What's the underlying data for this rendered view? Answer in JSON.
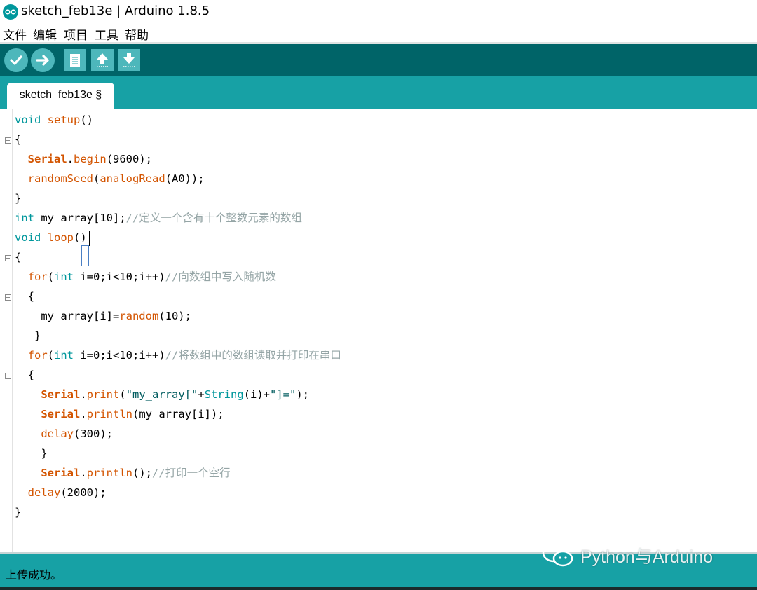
{
  "window": {
    "title": "sketch_feb13e | Arduino 1.8.5"
  },
  "menu": {
    "items": [
      "文件",
      "编辑",
      "项目",
      "工具",
      "帮助"
    ]
  },
  "toolbar": {
    "buttons": [
      "verify-icon",
      "upload-icon",
      "new-icon",
      "open-icon",
      "save-icon"
    ]
  },
  "tab": {
    "label": "sketch_feb13e §"
  },
  "code": {
    "l1": {
      "kw": "void",
      "fn": "setup",
      "rest": "()"
    },
    "l2": "{",
    "l3": {
      "ser": "Serial",
      "dot": ".",
      "fn": "begin",
      "rest": "(9600);"
    },
    "l4": {
      "fn": "randomSeed",
      "p1": "(",
      "fn2": "analogRead",
      "rest": "(A0));"
    },
    "l5": "}",
    "l6": {
      "kw": "int",
      "rest": " my_array[10];",
      "cm": "//定义一个含有十个整数元素的数组"
    },
    "l7": {
      "kw": "void",
      "fn": "loop",
      "rest": "()"
    },
    "l8": "{",
    "l9": {
      "kw": "for",
      "p1": "(",
      "kw2": "int",
      "rest": " i=0;i<10;i++)",
      "cm": "//向数组中写入随机数"
    },
    "l10": "{",
    "l11": {
      "rest": "my_array[i]=",
      "fn": "random",
      "rest2": "(10);"
    },
    "l12": "}",
    "l13": {
      "kw": "for",
      "p1": "(",
      "kw2": "int",
      "rest": " i=0;i<10;i++)",
      "cm": "//将数组中的数组读取并打印在串口"
    },
    "l14": "{",
    "l15": {
      "ser": "Serial",
      "dot": ".",
      "fn": "print",
      "p1": "(",
      "st": "\"my_array[\"",
      "rest": "+",
      "kw": "String",
      "rest2": "(i)+",
      "st2": "\"]=\"",
      "rest3": ");"
    },
    "l16": {
      "ser": "Serial",
      "dot": ".",
      "fn": "println",
      "rest": "(my_array[i]);"
    },
    "l17": {
      "fn": "delay",
      "rest": "(300);"
    },
    "l18": "}",
    "l19": {
      "ser": "Serial",
      "dot": ".",
      "fn": "println",
      "rest": "();",
      "cm": "//打印一个空行"
    },
    "l20": {
      "fn": "delay",
      "rest": "(2000);"
    },
    "l21": "}"
  },
  "status": {
    "message": "上传成功。"
  },
  "watermark": {
    "text": "Python与Arduino"
  },
  "colors": {
    "toolbar": "#006468",
    "tabstrip": "#17a1a5",
    "button": "#4db7bb",
    "keyword": "#00979c",
    "function": "#d35400",
    "comment": "#95a5a6"
  }
}
